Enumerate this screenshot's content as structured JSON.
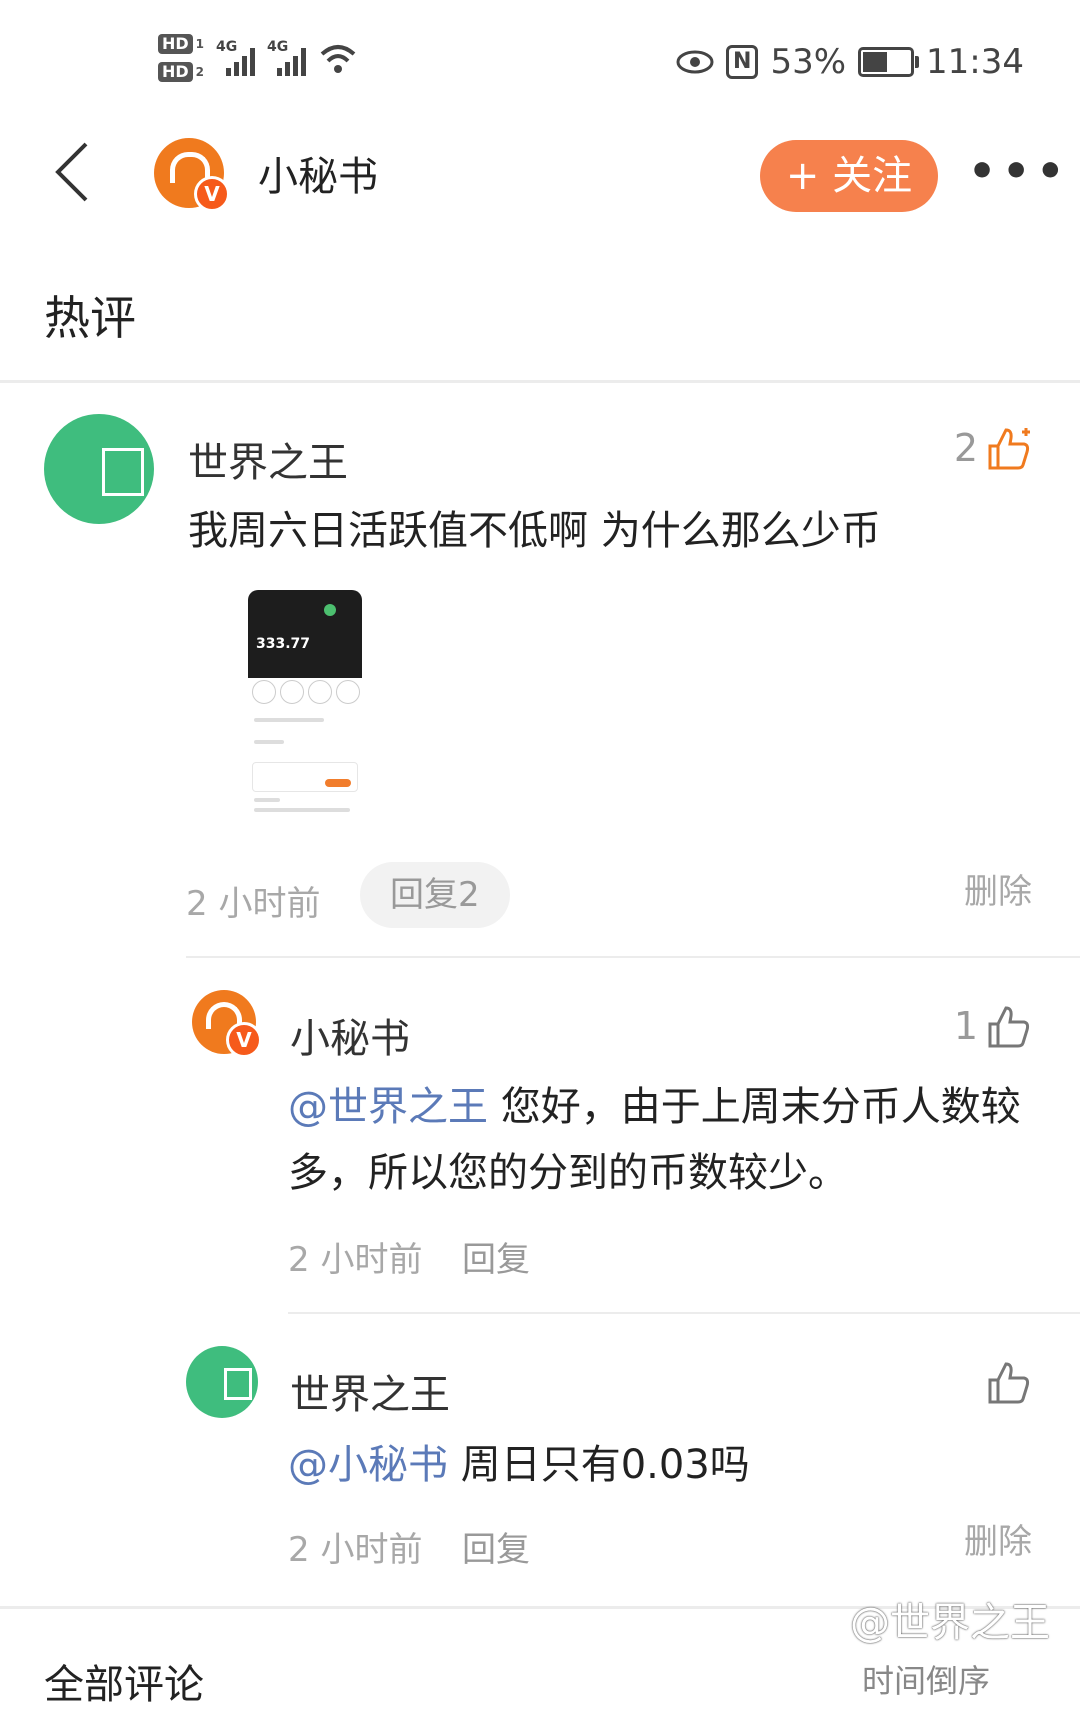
{
  "status_bar": {
    "sim1": "HD",
    "sim1_num": "1",
    "sim2": "HD",
    "sim2_num": "2",
    "net1": "4G",
    "net2": "4G",
    "nfc": "N",
    "battery": "53%",
    "time": "11:34"
  },
  "header": {
    "title": "小秘书",
    "follow": "+ 关注"
  },
  "section": {
    "title": "热评"
  },
  "comments": [
    {
      "name": "世界之王",
      "likes": "2",
      "text": "我周六日活跃值不低啊 为什么那么少币",
      "image_value": "333.77",
      "time": "2 小时前",
      "reply_count": "回复2",
      "delete": "删除"
    }
  ],
  "replies": [
    {
      "name": "小秘书",
      "likes": "1",
      "mention": "@世界之王",
      "text": " 您好，由于上周末分币人数较多，所以您的分到的币数较少。",
      "time": "2 小时前",
      "reply": "回复"
    },
    {
      "name": "世界之王",
      "likes": "",
      "mention": "@小秘书",
      "text": " 周日只有0.03吗",
      "time": "2 小时前",
      "reply": "回复",
      "delete": "删除"
    }
  ],
  "bottom": {
    "all_comments": "全部评论",
    "sort": "时间倒序"
  },
  "watermark": "@世界之王",
  "colors": {
    "brand_orange": "#f07a1e",
    "follow_button": "#f6814d",
    "mention_blue": "#5b7ab8",
    "avatar_green": "#3fbd7e"
  }
}
